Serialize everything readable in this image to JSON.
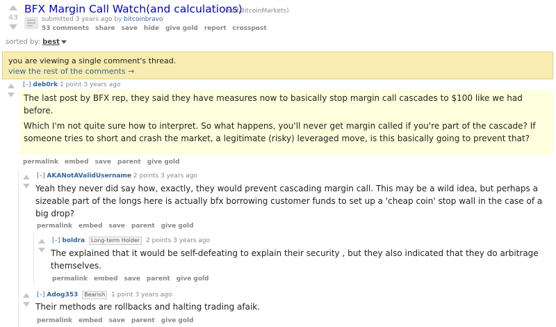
{
  "post": {
    "score": "43",
    "title": "BFX Margin Call Watch(and calculations)",
    "domain": "(self.BitcoinMarkets)",
    "submitted_prefix": "submitted 3 years ago by",
    "author": "bitcoinbravo",
    "buttons": [
      "53 comments",
      "share",
      "save",
      "hide",
      "give gold",
      "report",
      "crosspost"
    ]
  },
  "sort": {
    "label": "sorted by:",
    "value": "best"
  },
  "info_bar": {
    "text": "you are viewing a single comment's thread.",
    "link": "view the rest of the comments →"
  },
  "comments": [
    {
      "toggle": "[–]",
      "author": "deb0rk",
      "flair": "",
      "meta": "1 point 3 years ago",
      "paragraphs": [
        "The last post by BFX rep, they said they have measures now to basically stop margin call cascades to $100 like we had before.",
        "Which I'm not quite sure how to interpret. So what happens, you'll never get margin called if you're part of the cascade? If someone tries to short and crash the market, a legitimate (risky) leveraged move, is this basically going to prevent that?"
      ],
      "buttons": [
        "permalink",
        "embed",
        "save",
        "parent",
        "give gold"
      ]
    },
    {
      "toggle": "[–]",
      "author": "AKANotAValidUsername",
      "flair": "",
      "meta": "2 points 3 years ago",
      "paragraphs": [
        "Yeah they never did say how, exactly, they would prevent cascading margin call. This may be a wild idea, but perhaps a sizeable part of the longs here is actually bfx borrowing customer funds to set up a 'cheap coin' stop wall in the case of a big drop?"
      ],
      "buttons": [
        "permalink",
        "embed",
        "save",
        "parent",
        "give gold"
      ]
    },
    {
      "toggle": "[–]",
      "author": "boldra",
      "flair": "Long-term Holder",
      "meta": "2 points 3 years ago",
      "paragraphs": [
        "The explained that it would be self-defeating to explain their security , but they also indicated that they do arbitrage themselves."
      ],
      "buttons": [
        "permalink",
        "embed",
        "save",
        "parent",
        "give gold"
      ]
    },
    {
      "toggle": "[–]",
      "author": "Adog353",
      "flair": "Bearish",
      "meta": "1 point 3 years ago",
      "paragraphs": [
        "Their methods are rollbacks and halting trading afaik."
      ],
      "buttons": [
        "permalink",
        "embed",
        "save",
        "parent",
        "give gold"
      ]
    }
  ]
}
